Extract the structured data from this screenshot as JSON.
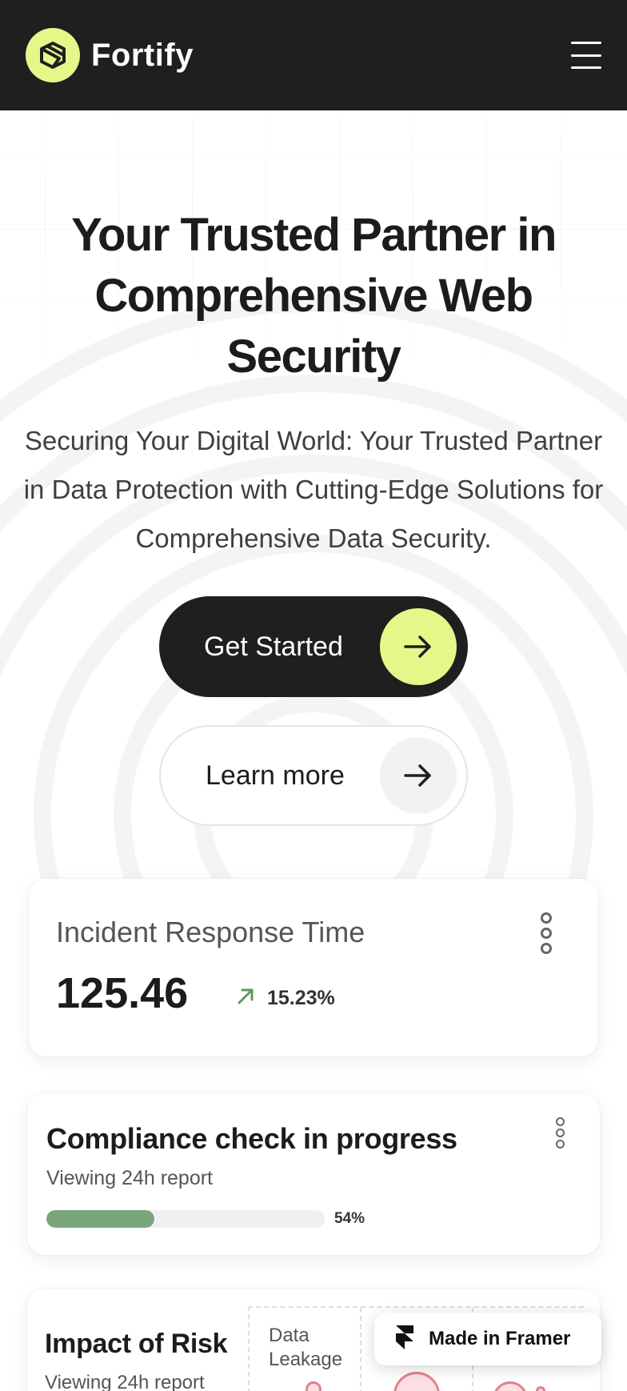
{
  "nav": {
    "brand": "Fortify",
    "logo_icon": "fortify-logo-icon",
    "menu_icon": "hamburger-menu-icon"
  },
  "hero": {
    "title": "Your Trusted Partner in Comprehensive Web Security",
    "subtitle": "Securing Your Digital World: Your Trusted Partner in Data Protection with Cutting-Edge Solutions for Comprehensive Data Security.",
    "primary_button": {
      "label": "Get Started",
      "icon": "arrow-right-icon"
    },
    "secondary_button": {
      "label": "Learn more",
      "icon": "arrow-right-icon"
    }
  },
  "cards": {
    "incident": {
      "title": "Incident Response Time",
      "value": "125.46",
      "trend_pct": "15.23%",
      "trend_icon": "arrow-up-right-icon"
    },
    "compliance": {
      "title": "Compliance check in progress",
      "subtitle": "Viewing 24h report",
      "progress_label": "54%",
      "progress": 0.54
    },
    "risk": {
      "title": "Impact of Risk",
      "subtitle": "Viewing 24h report",
      "column_label": "Data Leakage"
    }
  },
  "badge": {
    "label": "Made in Framer",
    "icon": "framer-logo-icon"
  },
  "colors": {
    "nav_bg": "#1f1f1f",
    "accent": "#e4f88a",
    "progress": "#79a67d",
    "risk": "#e3818c",
    "trend": "#5e9a63"
  }
}
